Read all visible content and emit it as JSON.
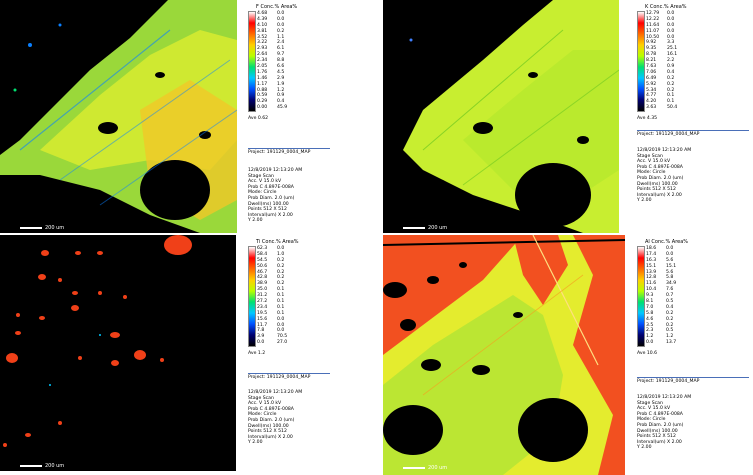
{
  "panels": [
    {
      "id": "f",
      "element": "F",
      "header": "Conc.% Area%",
      "levels": [
        "4.68",
        "4.39",
        "4.10",
        "3.81",
        "3.52",
        "3.22",
        "2.93",
        "2.64",
        "2.34",
        "2.05",
        "1.76",
        "1.46",
        "1.17",
        "0.88",
        "0.59",
        "0.29",
        "0.00"
      ],
      "areas": [
        "0.0",
        "0.0",
        "0.0",
        "0.2",
        "1.1",
        "2.4",
        "6.1",
        "9.7",
        "8.8",
        "6.6",
        "4.5",
        "2.9",
        "1.9",
        "1.2",
        "0.9",
        "0.4",
        "45.9"
      ],
      "average": "Ave 0.62",
      "scale_label": "200 um",
      "project": "Project: 191129_0004_MAP",
      "info": [
        "12/8/2019 12:13:20 AM",
        "Stage Scan",
        "Acc. V    15.0 kV",
        "Prob C   4.897E-008A",
        "Mode: Circle",
        "Prob Diam. 2.0 (um)",
        "Dwell(ms) 100.00",
        "Points  512 X 512",
        "Interval(um) X 2.00",
        "           Y 2.00"
      ]
    },
    {
      "id": "k",
      "element": "K",
      "header": "Conc.% Area%",
      "levels": [
        "12.79",
        "12.22",
        "11.64",
        "11.07",
        "10.50",
        "9.92",
        "9.35",
        "8.78",
        "8.21",
        "7.63",
        "7.06",
        "6.49",
        "5.92",
        "5.34",
        "4.77",
        "4.20",
        "3.63"
      ],
      "areas": [
        "0.0",
        "0.0",
        "0.0",
        "0.0",
        "0.0",
        "3.3",
        "25.1",
        "16.1",
        "2.2",
        "0.9",
        "0.4",
        "0.2",
        "0.2",
        "0.2",
        "0.1",
        "0.1",
        "50.4"
      ],
      "average": "Ave 4.35",
      "scale_label": "200 um",
      "project": "Project: 191129_0004_MAP",
      "info": [
        "12/8/2019 12:13:20 AM",
        "Stage Scan",
        "Acc. V    15.0 kV",
        "Prob C   4.897E-008A",
        "Mode: Circle",
        "Prob Diam. 2.0 (um)",
        "Dwell(ms) 100.00",
        "Points  512 X 512",
        "Interval(um) X 2.00",
        "           Y 2.00"
      ]
    },
    {
      "id": "ti",
      "element": "Ti",
      "header": "Conc.% Area%",
      "levels": [
        "62.3",
        "58.4",
        "54.5",
        "50.6",
        "46.7",
        "42.8",
        "38.9",
        "35.0",
        "31.2",
        "27.2",
        "23.4",
        "19.5",
        "15.6",
        "11.7",
        "7.8",
        "3.9",
        "0.0"
      ],
      "areas": [
        "0.0",
        "1.0",
        "0.2",
        "0.2",
        "0.2",
        "0.2",
        "0.2",
        "0.1",
        "0.1",
        "0.1",
        "0.1",
        "0.1",
        "0.0",
        "0.0",
        "0.0",
        "70.5",
        "27.0"
      ],
      "average": "Ave 1.2",
      "scale_label": "200 um",
      "project": "Project: 191129_0004_MAP",
      "info": [
        "12/8/2019 12:13:20 AM",
        "Stage Scan",
        "Acc. V    15.0 kV",
        "Prob C   4.897E-008A",
        "Mode: Circle",
        "Prob Diam. 2.0 (um)",
        "Dwell(ms) 100.00",
        "Points  512 X 512",
        "Interval(um) X 2.00",
        "           Y 2.00"
      ]
    },
    {
      "id": "al",
      "element": "Al",
      "header": "Conc.% Area%",
      "levels": [
        "18.6",
        "17.4",
        "16.3",
        "15.1",
        "13.9",
        "12.8",
        "11.6",
        "10.4",
        "9.3",
        "8.1",
        "7.0",
        "5.8",
        "4.6",
        "3.5",
        "2.3",
        "1.2",
        "0.0"
      ],
      "areas": [
        "0.0",
        "0.0",
        "5.6",
        "15.1",
        "5.6",
        "5.8",
        "34.9",
        "7.6",
        "0.7",
        "0.5",
        "0.4",
        "0.2",
        "0.2",
        "0.2",
        "0.5",
        "1.2",
        "13.7"
      ],
      "average": "Ave 10.6",
      "scale_label": "200 um",
      "project": "Project: 191129_0004_MAP",
      "info": [
        "12/8/2019 12:13:20 AM",
        "Stage Scan",
        "Acc. V    15.0 kV",
        "Prob C   4.897E-008A",
        "Mode: Circle",
        "Prob Diam. 2.0 (um)",
        "Dwell(ms) 100.00",
        "Points  512 X 512",
        "Interval(um) X 2.00",
        "           Y 2.00"
      ]
    }
  ],
  "colors": {
    "ramp": [
      "#ffffff",
      "#ff0000",
      "#ff6a00",
      "#ffd000",
      "#b8ff00",
      "#00e070",
      "#00c8ff",
      "#0050ff",
      "#000070",
      "#000000"
    ],
    "mineral_green": "#a6e63a",
    "mineral_yellow": "#e8f02a",
    "hot_red": "#f04018",
    "separator_blue": "#4a6fb8"
  }
}
